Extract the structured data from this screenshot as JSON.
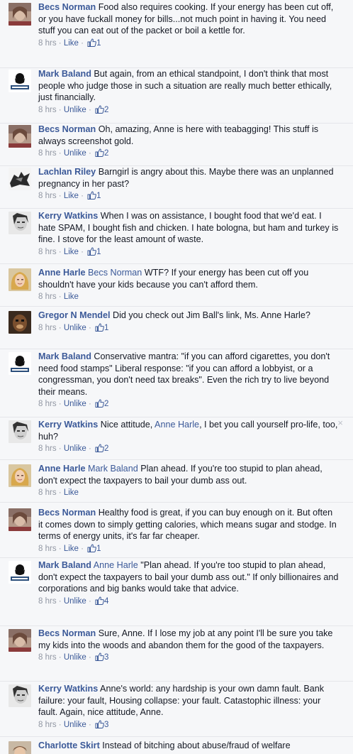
{
  "colors": {
    "link": "#3b5998",
    "text": "#141823",
    "meta": "#9197a3",
    "background": "#f6f7f9"
  },
  "comments": [
    {
      "author": "Becs Norman",
      "avatar": "becs-norman-photo",
      "mention": "",
      "text": "Food also requires cooking. If your energy has been cut off, or you have fuckall money for bills...not much point in having it. You need stuff you can eat out of the packet or boil a kettle for.",
      "time": "8 hrs",
      "action": "Like",
      "likes": "1"
    },
    {
      "author": "Mark Baland",
      "avatar": "mark-baland-photo",
      "mention": "",
      "text": "But again, from an ethical standpoint, I don't think that most people who judge those in such a situation are really much better ethically, just financially.",
      "time": "8 hrs",
      "action": "Unlike",
      "likes": "2"
    },
    {
      "author": "Becs Norman",
      "avatar": "becs-norman-photo",
      "mention": "",
      "text": "Oh, amazing, Anne is here with teabagging! This stuff is always screenshot gold.",
      "time": "8 hrs",
      "action": "Unlike",
      "likes": "2"
    },
    {
      "author": "Lachlan Riley",
      "avatar": "lachlan-riley-photo",
      "mention": "",
      "text": "Barngirl is angry about this. Maybe there was an unplanned pregnancy in her past?",
      "time": "8 hrs",
      "action": "Like",
      "likes": "1"
    },
    {
      "author": "Kerry Watkins",
      "avatar": "kerry-watkins-photo",
      "mention": "",
      "text": "When I was on assistance, I bought food that we'd eat. I hate SPAM, I bought fish and chicken. I hate bologna, but ham and turkey is fine. I stove for the least amount of waste.",
      "time": "8 hrs",
      "action": "Like",
      "likes": "1"
    },
    {
      "author": "Anne Harle",
      "avatar": "anne-harle-photo",
      "mention": "Becs Norman",
      "text": "WTF? If your energy has been cut off you shouldn't have your kids because you can't afford them.",
      "time": "8 hrs",
      "action": "Like",
      "likes": ""
    },
    {
      "author": "Gregor N Mendel",
      "avatar": "gregor-mendel-photo",
      "mention": "",
      "text": "Did you check out Jim Ball's link, Ms. Anne Harle?",
      "time": "8 hrs",
      "action": "Unlike",
      "likes": "1"
    },
    {
      "author": "Mark Baland",
      "avatar": "mark-baland-photo",
      "mention": "",
      "text": "Conservative mantra: \"if you can afford cigarettes, you don't need food stamps\" Liberal response: \"if you can afford a lobbyist, or a congressman, you don't need tax breaks\". Even the rich try to live beyond their means.",
      "time": "8 hrs",
      "action": "Unlike",
      "likes": "2"
    },
    {
      "author": "Kerry Watkins",
      "avatar": "kerry-watkins-photo",
      "mention": "",
      "text_before": "Nice attitude, ",
      "inline_mention": "Anne Harle",
      "text": ", I bet you call yourself pro-life, too, huh?",
      "time": "8 hrs",
      "action": "Unlike",
      "likes": "2",
      "close": "×"
    },
    {
      "author": "Anne Harle",
      "avatar": "anne-harle-photo",
      "mention": "Mark Baland",
      "text": "Plan ahead. If you're too stupid to plan ahead, don't expect the taxpayers to bail your dumb ass out.",
      "time": "8 hrs",
      "action": "Like",
      "likes": ""
    },
    {
      "author": "Becs Norman",
      "avatar": "becs-norman-photo",
      "mention": "",
      "text": "Healthy food is great, if you can buy enough on it. But often it comes down to simply getting calories, which means sugar and stodge. In terms of energy units, it's far far cheaper.",
      "time": "8 hrs",
      "action": "Like",
      "likes": "1"
    },
    {
      "author": "Mark Baland",
      "avatar": "mark-baland-photo",
      "mention": "Anne Harle",
      "text": "\"Plan ahead. If you're too stupid to plan ahead, don't expect the taxpayers to bail your dumb ass out.\" If only billionaires and corporations and big banks would take that advice.",
      "time": "8 hrs",
      "action": "Unlike",
      "likes": "4"
    },
    {
      "author": "Becs Norman",
      "avatar": "becs-norman-photo",
      "mention": "",
      "text": "Sure, Anne. If I lose my job at any point I'll be sure you take my kids into the woods and abandon them for the good of the taxpayers.",
      "time": "8 hrs",
      "action": "Unlike",
      "likes": "3"
    },
    {
      "author": "Kerry Watkins",
      "avatar": "kerry-watkins-photo",
      "mention": "",
      "text": "Anne's world: any hardship is your own damn fault. Bank failure: your fault, Housing collapse: your fault. Catastophic illness: your fault. Again, nice attitude, Anne.",
      "time": "8 hrs",
      "action": "Unlike",
      "likes": "3"
    },
    {
      "author": "Charlotte Skirt",
      "avatar": "charlotte-skirt-photo",
      "mention": "",
      "text": "Instead of bitching about abuse/fraud of welfare",
      "time": "",
      "action": "",
      "likes": ""
    }
  ]
}
